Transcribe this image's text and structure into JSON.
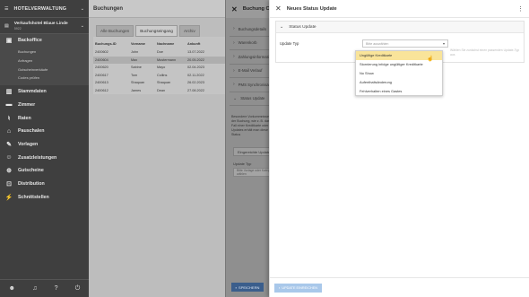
{
  "sidebar": {
    "app_title": "HOTELVERWALTUNG",
    "hotel_name": "Verkaufshotel Blaue Linde",
    "hotel_id": "5922",
    "sections": [
      {
        "label": "Backoffice",
        "icon": "briefcase-icon",
        "subs": [
          "Buchungen",
          "Anfragen",
          "Gutscheinverkäufe",
          "Codes prüfen"
        ]
      }
    ],
    "items": [
      {
        "label": "Stammdaten",
        "icon": "book-icon"
      },
      {
        "label": "Zimmer",
        "icon": "bed-icon"
      },
      {
        "label": "Raten",
        "icon": "rates-icon"
      },
      {
        "label": "Pauschalen",
        "icon": "tag-icon"
      },
      {
        "label": "Vorlagen",
        "icon": "template-icon"
      },
      {
        "label": "Zusatzleistungen",
        "icon": "extras-icon"
      },
      {
        "label": "Gutscheine",
        "icon": "voucher-icon"
      },
      {
        "label": "Distribution",
        "icon": "distribution-icon"
      },
      {
        "label": "Schnittstellen",
        "icon": "plug-icon"
      }
    ],
    "footer_icons": [
      "user-icon",
      "bell-icon",
      "help-icon",
      "power-icon"
    ]
  },
  "main": {
    "title": "Buchungen",
    "tabs": [
      "Alle Buchungen",
      "Buchungseingang",
      "Archiv"
    ],
    "columns": [
      "Buchungs-ID",
      "Vorname",
      "Nachname",
      "Ankunft"
    ],
    "rows": [
      [
        "2400602",
        "John",
        "Doe",
        "13.07.2022"
      ],
      [
        "2400604",
        "Max",
        "Mustermann",
        "20.05.2022"
      ],
      [
        "2400620",
        "Sabine",
        "Mayo",
        "02.04.2023"
      ],
      [
        "2400617",
        "Tom",
        "Collins",
        "02.11.2022"
      ],
      [
        "2400613",
        "Shaquan",
        "Shaquan",
        "26.02.2023"
      ],
      [
        "2400612",
        "James",
        "Dean",
        "27.08.2022"
      ]
    ]
  },
  "panel_mid": {
    "title": "Buchung CB",
    "sections": [
      "Buchungsdetails",
      "Warenkorb",
      "Zahlungsinformationen",
      "E-Mail Verlauf",
      "PMS Synchronisation",
      "Status Update"
    ],
    "note": "Besondere Vorkommnisse mit der Buchung, wie z. B. dass im Fall einer Kreditkarte oder Updates erhält man diese Status",
    "button": "Eingereichte Updates",
    "field_label": "Update Typ",
    "field_placeholder": "Bitte Vorlage oder Kategorie wählen",
    "save": "SPEICHERN"
  },
  "panel_right": {
    "title": "Neues Status Update",
    "card_title": "Status Update",
    "field_label": "Update Typ",
    "select_placeholder": "Bitte auswählen",
    "hint": "Wählen Sie zunächst einen passenden Update-Typ aus",
    "options": [
      "Ungültige Kreditkarte",
      "Stornierung infolge ungültiger Kreditkarte",
      "No Show",
      "Aufenthaltsänderung",
      "Fehlverhalten eines Gastes"
    ],
    "submit": "UPDATE EINREICHEN"
  },
  "colors": {
    "sidebar_bg": "#3f3f3f",
    "highlight": "#f9e49a",
    "primary": "#3b5e8c"
  }
}
